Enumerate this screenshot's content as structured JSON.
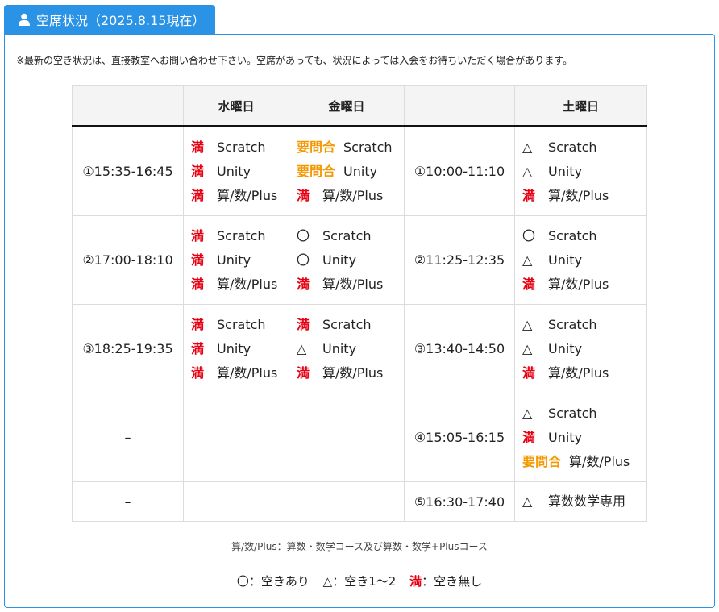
{
  "header": {
    "title": "空席状況（2025.8.15現在）",
    "icon": "user-icon"
  },
  "notice": "※最新の空き状況は、直接教室へお問い合わせ下さい。空席があっても、状況によっては入会をお待ちいただく場合があります。",
  "table": {
    "headers": [
      "",
      "水曜日",
      "金曜日",
      "",
      "土曜日"
    ],
    "rows": [
      {
        "time1": "①15:35-16:45",
        "wed": [
          {
            "mark": "満",
            "cls": "full",
            "course": "Scratch"
          },
          {
            "mark": "満",
            "cls": "full",
            "course": "Unity"
          },
          {
            "mark": "満",
            "cls": "full",
            "course": "算/数/Plus"
          }
        ],
        "fri": [
          {
            "mark": "要問合",
            "cls": "ask",
            "course": "Scratch"
          },
          {
            "mark": "要問合",
            "cls": "ask",
            "course": "Unity"
          },
          {
            "mark": "満",
            "cls": "full",
            "course": "算/数/Plus"
          }
        ],
        "time2": "①10:00-11:10",
        "sat": [
          {
            "mark": "△",
            "cls": "",
            "course": "Scratch"
          },
          {
            "mark": "△",
            "cls": "",
            "course": "Unity"
          },
          {
            "mark": "満",
            "cls": "full",
            "course": "算/数/Plus"
          }
        ]
      },
      {
        "time1": "②17:00-18:10",
        "wed": [
          {
            "mark": "満",
            "cls": "full",
            "course": "Scratch"
          },
          {
            "mark": "満",
            "cls": "full",
            "course": "Unity"
          },
          {
            "mark": "満",
            "cls": "full",
            "course": "算/数/Plus"
          }
        ],
        "fri": [
          {
            "mark": "〇",
            "cls": "",
            "course": "Scratch"
          },
          {
            "mark": "〇",
            "cls": "",
            "course": "Unity"
          },
          {
            "mark": "満",
            "cls": "full",
            "course": "算/数/Plus"
          }
        ],
        "time2": "②11:25-12:35",
        "sat": [
          {
            "mark": "〇",
            "cls": "",
            "course": "Scratch"
          },
          {
            "mark": "△",
            "cls": "",
            "course": "Unity"
          },
          {
            "mark": "満",
            "cls": "full",
            "course": "算/数/Plus"
          }
        ]
      },
      {
        "time1": "③18:25-19:35",
        "wed": [
          {
            "mark": "満",
            "cls": "full",
            "course": "Scratch"
          },
          {
            "mark": "満",
            "cls": "full",
            "course": "Unity"
          },
          {
            "mark": "満",
            "cls": "full",
            "course": "算/数/Plus"
          }
        ],
        "fri": [
          {
            "mark": "満",
            "cls": "full",
            "course": "Scratch"
          },
          {
            "mark": "△",
            "cls": "",
            "course": "Unity"
          },
          {
            "mark": "満",
            "cls": "full",
            "course": "算/数/Plus"
          }
        ],
        "time2": "③13:40-14:50",
        "sat": [
          {
            "mark": "△",
            "cls": "",
            "course": "Scratch"
          },
          {
            "mark": "△",
            "cls": "",
            "course": "Unity"
          },
          {
            "mark": "満",
            "cls": "full",
            "course": "算/数/Plus"
          }
        ]
      },
      {
        "time1": "–",
        "wed": [],
        "fri": [],
        "time2": "④15:05-16:15",
        "sat": [
          {
            "mark": "△",
            "cls": "",
            "course": "Scratch"
          },
          {
            "mark": "満",
            "cls": "full",
            "course": "Unity"
          },
          {
            "mark": "要問合",
            "cls": "ask",
            "course": "算/数/Plus"
          }
        ]
      },
      {
        "time1": "–",
        "wed": [],
        "fri": [],
        "time2": "⑤16:30-17:40",
        "sat": [
          {
            "mark": "△",
            "cls": "",
            "course": "算数数学専用"
          }
        ]
      }
    ]
  },
  "legend_note": "算/数/Plus：算数・数学コース及び算数・数学+Plusコース",
  "legend": {
    "available": "〇：空きあり",
    "few": "△：空き1〜2",
    "full_mark": "満",
    "full_text": "：空き無し"
  },
  "colors": {
    "accent": "#2b93e6",
    "full": "#e60012",
    "ask": "#f39800"
  }
}
